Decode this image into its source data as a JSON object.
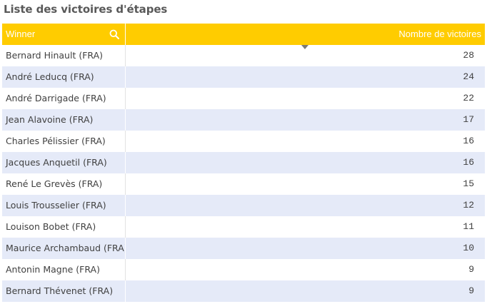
{
  "title": "Liste des victoires d'étapes",
  "table": {
    "columns": {
      "winner": "Winner",
      "count": "Nombre de victoires"
    },
    "rows": [
      {
        "winner": "Bernard Hinault (FRA)",
        "count": "28"
      },
      {
        "winner": "André Leducq (FRA)",
        "count": "24"
      },
      {
        "winner": "André Darrigade (FRA)",
        "count": "22"
      },
      {
        "winner": "Jean Alavoine (FRA)",
        "count": "17"
      },
      {
        "winner": "Charles Pélissier (FRA)",
        "count": "16"
      },
      {
        "winner": "Jacques Anquetil (FRA)",
        "count": "16"
      },
      {
        "winner": "René Le Grevès (FRA)",
        "count": "15"
      },
      {
        "winner": "Louis Trousselier (FRA)",
        "count": "12"
      },
      {
        "winner": "Louison Bobet (FRA)",
        "count": "11"
      },
      {
        "winner": "Maurice Archambaud (FRA)",
        "count": "10"
      },
      {
        "winner": "Antonin Magne (FRA)",
        "count": "9"
      },
      {
        "winner": "Bernard Thévenet (FRA)",
        "count": "9"
      }
    ]
  },
  "icons": {
    "search": "search-icon",
    "sort": "sort-descending-icon"
  },
  "colors": {
    "header_bg": "#ffcc00",
    "alt_row_bg": "#e5eaf8",
    "title": "#595959"
  }
}
